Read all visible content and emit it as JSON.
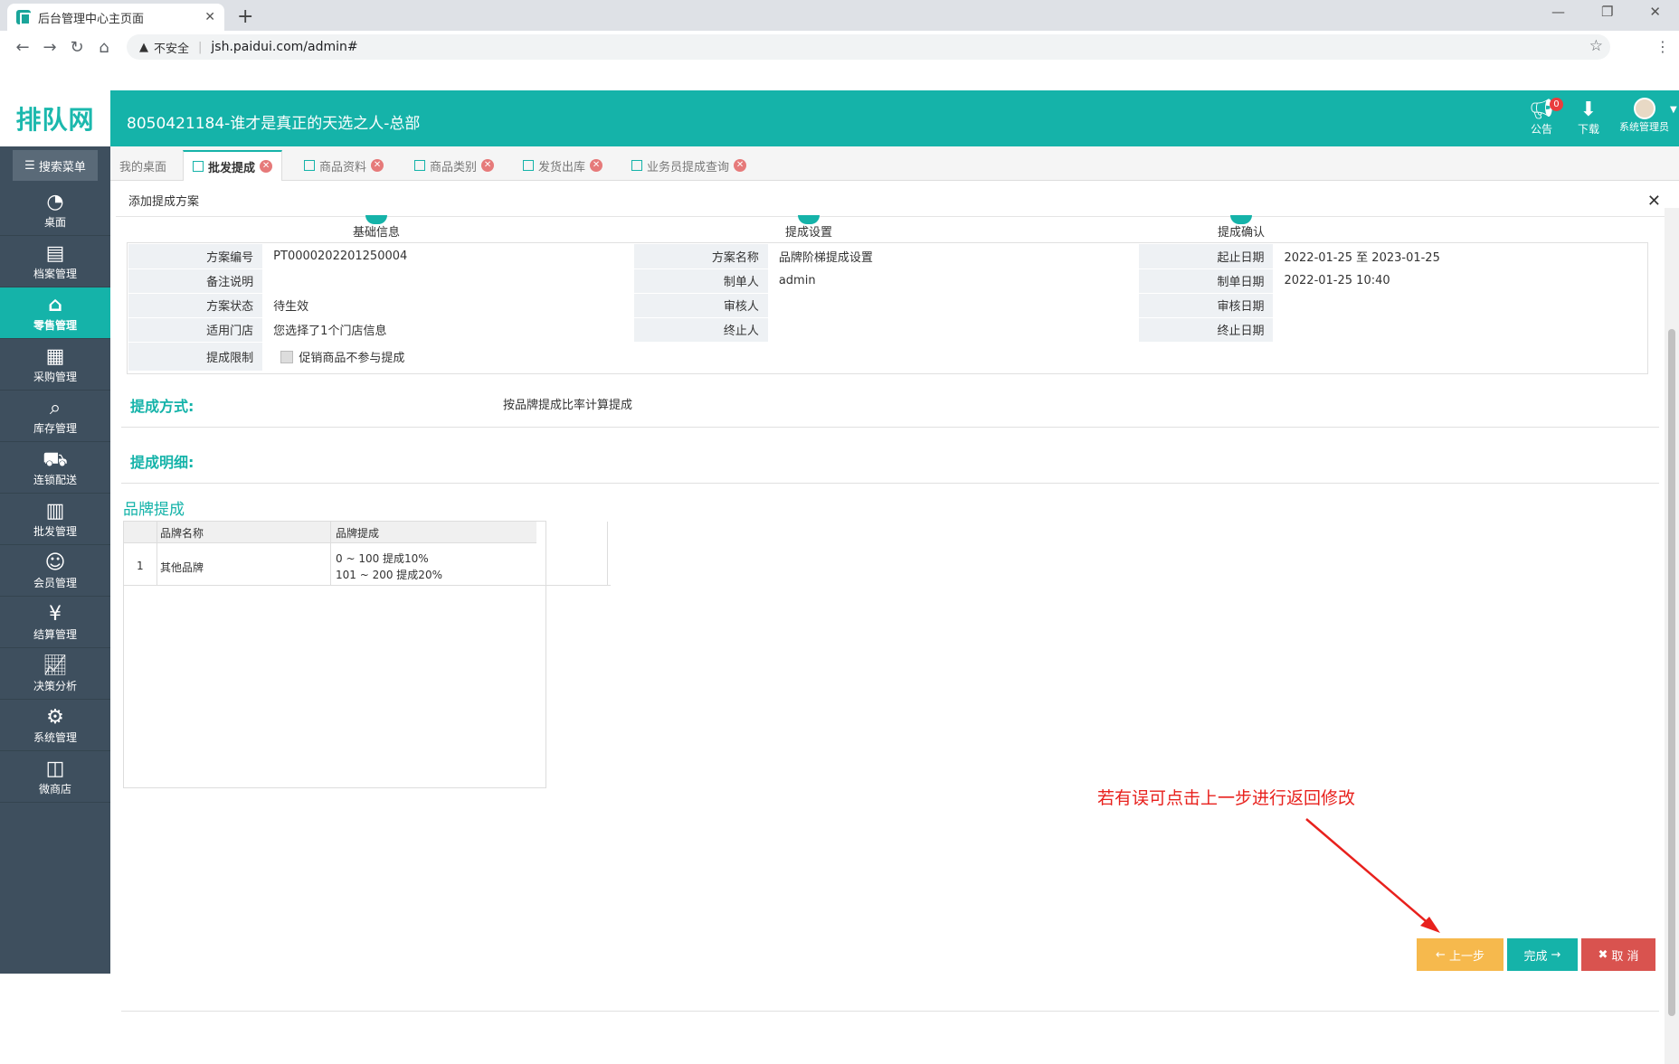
{
  "browser": {
    "tab_title": "后台管理中心主页面",
    "url_warning": "不安全",
    "url": "jsh.paidui.com/admin#"
  },
  "app": {
    "logo": "排队网",
    "header_title": "8050421184-谁才是真正的天选之人-总部",
    "notice_label": "公告",
    "notice_count": "0",
    "download_label": "下载",
    "user_label": "系统管理员"
  },
  "sidebar": {
    "search_label": "搜索菜单",
    "items": [
      {
        "label": "桌面",
        "icon": "dashboard-icon"
      },
      {
        "label": "档案管理",
        "icon": "archive-icon"
      },
      {
        "label": "零售管理",
        "icon": "store-icon"
      },
      {
        "label": "采购管理",
        "icon": "purchase-icon"
      },
      {
        "label": "库存管理",
        "icon": "inventory-icon"
      },
      {
        "label": "连锁配送",
        "icon": "truck-icon"
      },
      {
        "label": "批发管理",
        "icon": "wholesale-icon"
      },
      {
        "label": "会员管理",
        "icon": "member-icon"
      },
      {
        "label": "结算管理",
        "icon": "settlement-icon"
      },
      {
        "label": "决策分析",
        "icon": "chart-icon"
      },
      {
        "label": "系统管理",
        "icon": "gear-icon"
      },
      {
        "label": "微商店",
        "icon": "shop-icon"
      }
    ]
  },
  "tabs": [
    {
      "label": "我的桌面"
    },
    {
      "label": "批发提成"
    },
    {
      "label": "商品资料"
    },
    {
      "label": "商品类别"
    },
    {
      "label": "发货出库"
    },
    {
      "label": "业务员提成查询"
    }
  ],
  "modal": {
    "title": "添加提成方案",
    "steps": [
      "基础信息",
      "提成设置",
      "提成确认"
    ],
    "info": {
      "plan_no_label": "方案编号",
      "plan_no": "PT0000202201250004",
      "plan_name_label": "方案名称",
      "plan_name": "品牌阶梯提成设置",
      "date_range_label": "起止日期",
      "date_range": "2022-01-25 至 2023-01-25",
      "remark_label": "备注说明",
      "remark": "",
      "creator_label": "制单人",
      "creator": "admin",
      "create_date_label": "制单日期",
      "create_date": "2022-01-25 10:40",
      "status_label": "方案状态",
      "status": "待生效",
      "auditor_label": "审核人",
      "auditor": "",
      "audit_date_label": "审核日期",
      "audit_date": "",
      "store_label": "适用门店",
      "store": "您选择了1个门店信息",
      "terminator_label": "终止人",
      "terminator": "",
      "terminate_date_label": "终止日期",
      "terminate_date": "",
      "limit_label": "提成限制",
      "limit_option": "促销商品不参与提成"
    },
    "method_title": "提成方式:",
    "method_value": "按品牌提成比率计算提成",
    "detail_title": "提成明细:",
    "brand_title": "品牌提成",
    "grid": {
      "headers": [
        "品牌名称",
        "品牌提成"
      ],
      "rows": [
        {
          "no": "1",
          "brand": "其他品牌",
          "tier1": "0 ~ 100 提成10%",
          "tier2": "101 ~ 200 提成20%"
        }
      ]
    }
  },
  "annotation": "若有误可点击上一步进行返回修改",
  "buttons": {
    "prev": "上一步",
    "done": "完成",
    "cancel": "取 消"
  },
  "colors": {
    "accent": "#15b3a9",
    "sidebar": "#3e4f5e",
    "prev_button": "#f6b94d",
    "cancel_button": "#d9534f",
    "annotation": "#e8211d"
  }
}
